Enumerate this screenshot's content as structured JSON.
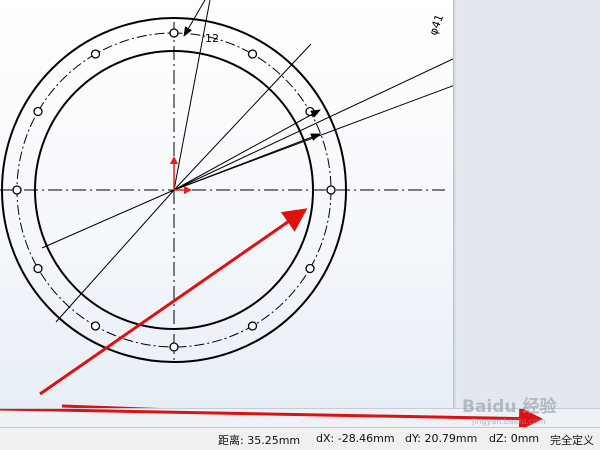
{
  "drawing": {
    "hole_count_label": "12",
    "diameter_label": "φ41"
  },
  "status": {
    "distance": "距离: 35.25mm",
    "dx": "dX: -28.46mm",
    "dy": "dY: 20.79mm",
    "dz": "dZ: 0mm",
    "state": "完全定义"
  },
  "watermark": {
    "brand": "Baidu 经验",
    "url": "jingyan.baidu.com"
  },
  "colors": {
    "geometry": "#000000",
    "arrow": "#e01010",
    "origin": "#e02020"
  }
}
